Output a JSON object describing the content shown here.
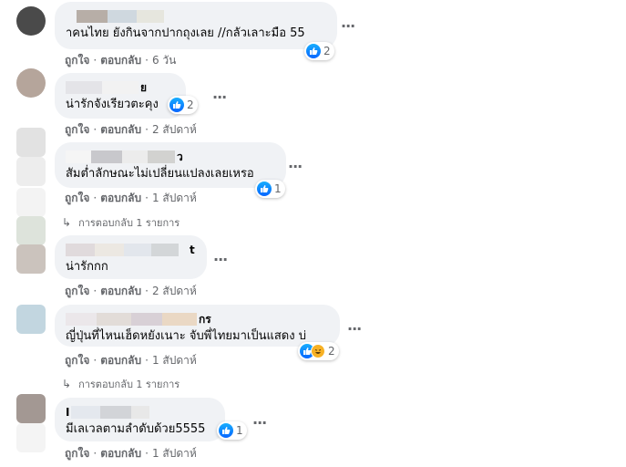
{
  "comments": [
    {
      "text": "าคนไทย ยังกินจากปากถุงเลย //กลัวเลาะมือ 55",
      "reactions": {
        "count": "2",
        "types": [
          "like"
        ]
      },
      "actions": {
        "like": "ถูกใจ",
        "reply": "ตอบกลับ",
        "time": "6 วัน"
      },
      "name_tail": ""
    },
    {
      "text": "น่ารักจังเรียวตะคุง",
      "reactions": {
        "count": "2",
        "types": [
          "like"
        ]
      },
      "actions": {
        "like": "ถูกใจ",
        "reply": "ตอบกลับ",
        "time": "2 สัปดาห์"
      },
      "name_tail": "ย"
    },
    {
      "text": "สัมต่ำลักษณะไม่เปลี่ยนแปลงเลยเหรอ",
      "reactions": {
        "count": "1",
        "types": [
          "like"
        ]
      },
      "actions": {
        "like": "ถูกใจ",
        "reply": "ตอบกลับ",
        "time": "1 สัปดาห์"
      },
      "replies_link": "การตอบกลับ 1 รายการ",
      "name_tail": "ว"
    },
    {
      "text": "น่ารักกก",
      "actions": {
        "like": "ถูกใจ",
        "reply": "ตอบกลับ",
        "time": "2 สัปดาห์"
      },
      "name_tail": "t"
    },
    {
      "text": "ญี่ปุ่นที่ไหนเฮ็ดหยังเนาะ จับพี่ไทยมาเป็นแสดง บ่",
      "reactions": {
        "count": "2",
        "types": [
          "like",
          "haha"
        ]
      },
      "actions": {
        "like": "ถูกใจ",
        "reply": "ตอบกลับ",
        "time": "1 สัปดาห์"
      },
      "replies_link": "การตอบกลับ 1 รายการ",
      "name_tail": "กร"
    },
    {
      "text": "มีเลเวลตามลำดับด้วย5555",
      "reactions": {
        "count": "1",
        "types": [
          "like"
        ]
      },
      "actions": {
        "like": "ถูกใจ",
        "reply": "ตอบกลับ",
        "time": "1 สัปดาห์"
      },
      "name_tail": ""
    }
  ],
  "icons": {
    "more": "more-options-icon",
    "reply_arrow": "reply-arrow-icon",
    "like": "like-icon",
    "haha": "haha-icon"
  },
  "colors": {
    "bubble": "#f0f2f5",
    "meta": "#65676b",
    "like_blue": "#0866ff"
  }
}
